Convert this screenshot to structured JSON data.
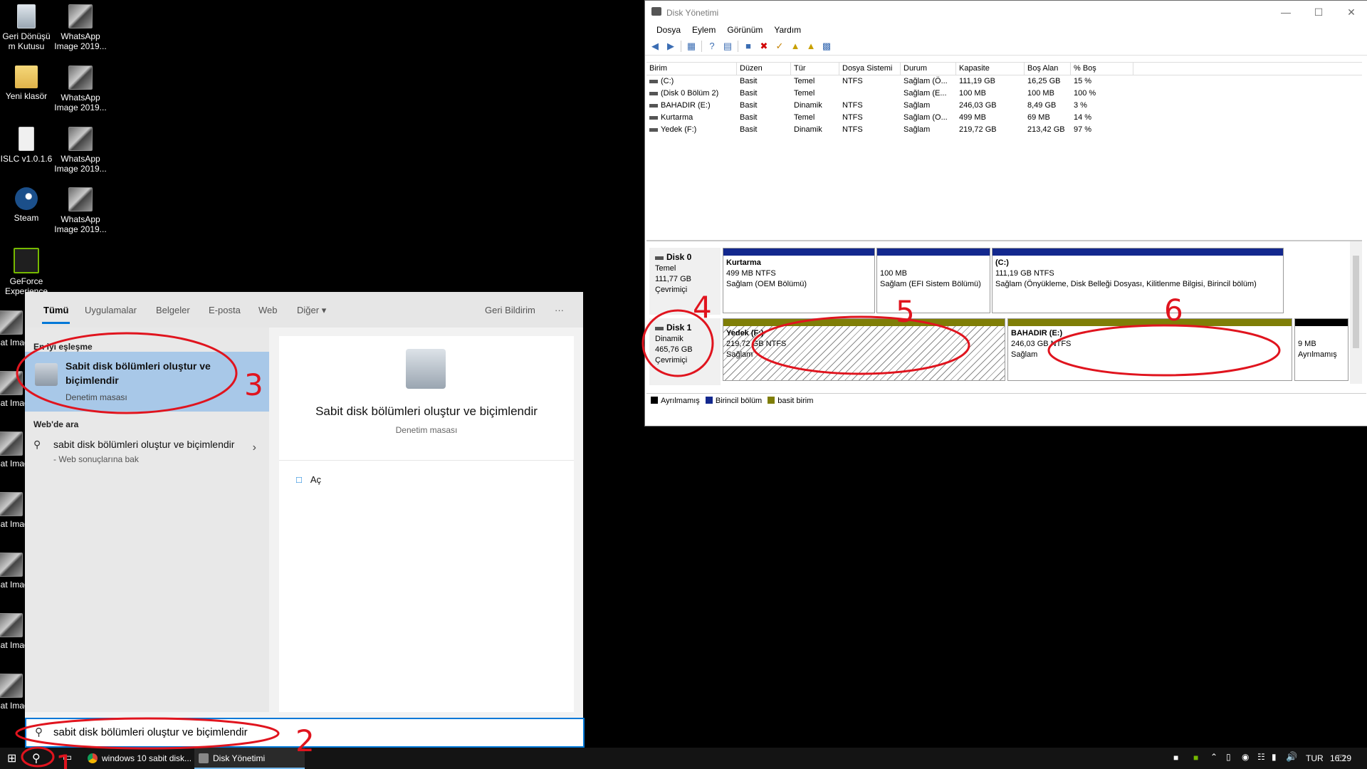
{
  "desktop": {
    "icons": [
      {
        "label": "Geri Dönüşü m Kutusu",
        "icon": "recycle-bin-icon"
      },
      {
        "label": "WhatsApp Image 2019...",
        "icon": "image-file-icon"
      },
      {
        "label": "Yeni klasör",
        "icon": "folder-icon"
      },
      {
        "label": "WhatsApp Image 2019...",
        "icon": "image-file-icon"
      },
      {
        "label": "ISLC v1.0.1.6",
        "icon": "app-icon"
      },
      {
        "label": "WhatsApp Image 2019...",
        "icon": "image-file-icon"
      },
      {
        "label": "Steam",
        "icon": "steam-icon"
      },
      {
        "label": "WhatsApp Image 2019...",
        "icon": "image-file-icon"
      },
      {
        "label": "GeForce Experience",
        "icon": "nvidia-icon"
      },
      {
        "label": "What Image",
        "icon": "image-file-icon"
      },
      {
        "label": "What Image",
        "icon": "image-file-icon"
      },
      {
        "label": "What Image",
        "icon": "image-file-icon"
      },
      {
        "label": "What Image",
        "icon": "image-file-icon"
      },
      {
        "label": "What Image",
        "icon": "image-file-icon"
      },
      {
        "label": "What Image",
        "icon": "image-file-icon"
      },
      {
        "label": "What Image",
        "icon": "image-file-icon"
      }
    ]
  },
  "disk_mgmt": {
    "title": "Disk Yönetimi",
    "menu": [
      "Dosya",
      "Eylem",
      "Görünüm",
      "Yardım"
    ],
    "columns": [
      "Birim",
      "Düzen",
      "Tür",
      "Dosya Sistemi",
      "Durum",
      "Kapasite",
      "Boş Alan",
      "% Boş"
    ],
    "rows": [
      [
        "(C:)",
        "Basit",
        "Temel",
        "NTFS",
        "Sağlam (Ö...",
        "111,19 GB",
        "16,25 GB",
        "15 %"
      ],
      [
        "(Disk 0 Bölüm 2)",
        "Basit",
        "Temel",
        "",
        "Sağlam (E...",
        "100 MB",
        "100 MB",
        "100 %"
      ],
      [
        "BAHADIR (E:)",
        "Basit",
        "Dinamik",
        "NTFS",
        "Sağlam",
        "246,03 GB",
        "8,49 GB",
        "3 %"
      ],
      [
        "Kurtarma",
        "Basit",
        "Temel",
        "NTFS",
        "Sağlam (O...",
        "499 MB",
        "69 MB",
        "14 %"
      ],
      [
        "Yedek (F:)",
        "Basit",
        "Dinamik",
        "NTFS",
        "Sağlam",
        "219,72 GB",
        "213,42 GB",
        "97 %"
      ]
    ],
    "disk0": {
      "name": "Disk 0",
      "type": "Temel",
      "size": "111,77 GB",
      "status": "Çevrimiçi",
      "parts": [
        {
          "name": "Kurtarma",
          "size": "499 MB NTFS",
          "status": "Sağlam (OEM Bölümü)"
        },
        {
          "name": "",
          "size": "100 MB",
          "status": "Sağlam (EFI Sistem Bölümü)"
        },
        {
          "name": "(C:)",
          "size": "111,19 GB NTFS",
          "status": "Sağlam (Önyükleme, Disk Belleği Dosyası, Kilitlenme Bilgisi, Birincil bölüm)"
        }
      ]
    },
    "disk1": {
      "name": "Disk 1",
      "type": "Dinamik",
      "size": "465,76 GB",
      "status": "Çevrimiçi",
      "parts": [
        {
          "name": "Yedek  (F:)",
          "size": "219,72 GB NTFS",
          "status": "Sağlam"
        },
        {
          "name": "BAHADIR  (E:)",
          "size": "246,03 GB NTFS",
          "status": "Sağlam"
        },
        {
          "name": "",
          "size": "9 MB",
          "status": "Ayrılmamış"
        }
      ]
    },
    "legend": [
      "Ayrılmamış",
      "Birincil bölüm",
      "basit birim"
    ],
    "colors": {
      "unallocated": "#000000",
      "primary": "#13288e",
      "simple": "#7f7e07"
    }
  },
  "search": {
    "tabs": [
      "Tümü",
      "Uygulamalar",
      "Belgeler",
      "E-posta",
      "Web",
      "Diğer"
    ],
    "feedback": "Geri Bildirim",
    "more": "···",
    "best_match_header": "En iyi eşleşme",
    "best_match_title": "Sabit disk bölümleri oluştur ve biçimlendir",
    "best_match_sub": "Denetim masası",
    "web_header": "Web'de ara",
    "web_query": "sabit disk bölümleri oluştur ve biçimlendir",
    "web_sub": "- Web sonuçlarına bak",
    "preview_title": "Sabit disk bölümleri oluştur ve biçimlendir",
    "preview_sub": "Denetim masası",
    "open_label": "Aç",
    "query": "sabit disk bölümleri oluştur ve biçimlendir"
  },
  "taskbar": {
    "apps": [
      "windows 10 sabit disk...",
      "Disk Yönetimi"
    ],
    "lang": "TUR",
    "time": "16:29"
  },
  "annotations": [
    "1",
    "2",
    "3",
    "4",
    "5",
    "6"
  ]
}
